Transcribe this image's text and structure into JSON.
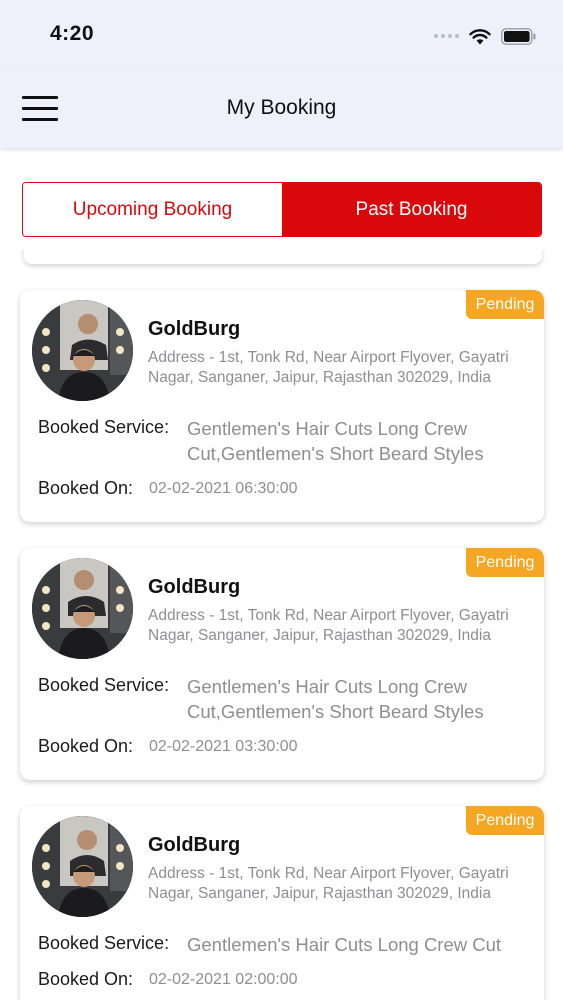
{
  "status_bar": {
    "time": "4:20"
  },
  "header": {
    "title": "My Booking",
    "menu_icon": "hamburger-icon"
  },
  "tabs": [
    {
      "label": "Upcoming Booking",
      "active": false
    },
    {
      "label": "Past Booking",
      "active": true
    }
  ],
  "colors": {
    "accent": "#d9090b",
    "badge": "#f5a623",
    "muted": "#8e8e93",
    "header_bg": "#eef1f9"
  },
  "labels": {
    "service": "Booked Service:",
    "booked_on": "Booked On:"
  },
  "bookings": [
    {
      "status": "Pending",
      "name": "GoldBurg",
      "address": "Address - 1st, Tonk Rd, Near Airport Flyover, Gayatri Nagar, Sanganer, Jaipur, Rajasthan 302029, India",
      "service": "Gentlemen's Hair Cuts Long Crew Cut,Gentlemen's Short Beard Styles",
      "booked_on": "02-02-2021 06:30:00"
    },
    {
      "status": "Pending",
      "name": "GoldBurg",
      "address": "Address - 1st, Tonk Rd, Near Airport Flyover, Gayatri Nagar, Sanganer, Jaipur, Rajasthan 302029, India",
      "service": "Gentlemen's Hair Cuts Long Crew Cut,Gentlemen's Short Beard Styles",
      "booked_on": "02-02-2021 03:30:00"
    },
    {
      "status": "Pending",
      "name": "GoldBurg",
      "address": "Address - 1st, Tonk Rd, Near Airport Flyover, Gayatri Nagar, Sanganer, Jaipur, Rajasthan 302029, India",
      "service": "Gentlemen's Hair Cuts Long Crew Cut",
      "booked_on": "02-02-2021 02:00:00"
    }
  ]
}
